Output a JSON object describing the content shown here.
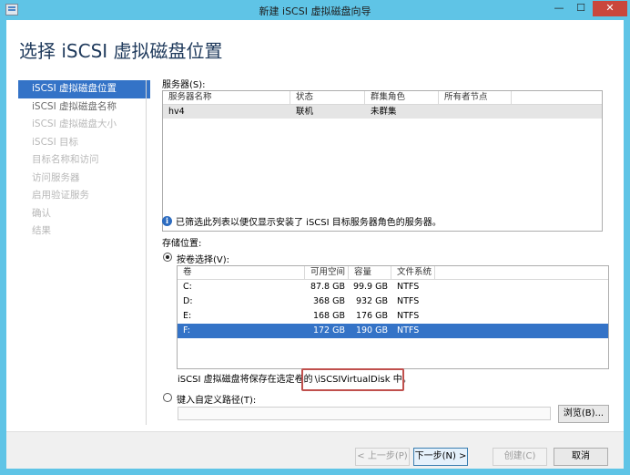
{
  "window": {
    "title": "新建 iSCSI 虚拟磁盘向导",
    "min_glyph": "—",
    "max_glyph": "☐",
    "close_glyph": "✕"
  },
  "page": {
    "title": "选择 iSCSI 虚拟磁盘位置"
  },
  "steps": [
    {
      "label": "iSCSI 虚拟磁盘位置",
      "state": "active"
    },
    {
      "label": "iSCSI 虚拟磁盘名称",
      "state": "done"
    },
    {
      "label": "iSCSI 虚拟磁盘大小",
      "state": "pending"
    },
    {
      "label": "iSCSI 目标",
      "state": "pending"
    },
    {
      "label": "目标名称和访问",
      "state": "pending"
    },
    {
      "label": "访问服务器",
      "state": "pending"
    },
    {
      "label": "启用验证服务",
      "state": "pending"
    },
    {
      "label": "确认",
      "state": "pending"
    },
    {
      "label": "结果",
      "state": "pending"
    }
  ],
  "server": {
    "label": "服务器(S):",
    "columns": [
      "服务器名称",
      "状态",
      "群集角色",
      "所有者节点"
    ],
    "rows": [
      {
        "name": "hv4",
        "status": "联机",
        "cluster_role": "未群集",
        "owner_node": ""
      }
    ],
    "info": "已筛选此列表以便仅显示安装了 iSCSI 目标服务器角色的服务器。"
  },
  "storage": {
    "label": "存储位置:",
    "by_volume_label": "按卷选择(V):",
    "columns": [
      "卷",
      "可用空间",
      "容量",
      "文件系统"
    ],
    "volumes": [
      {
        "volume": "C:",
        "free": "87.8 GB",
        "capacity": "99.9 GB",
        "fs": "NTFS"
      },
      {
        "volume": "D:",
        "free": "368 GB",
        "capacity": "932 GB",
        "fs": "NTFS"
      },
      {
        "volume": "E:",
        "free": "168 GB",
        "capacity": "176 GB",
        "fs": "NTFS"
      },
      {
        "volume": "F:",
        "free": "172 GB",
        "capacity": "190 GB",
        "fs": "NTFS"
      }
    ],
    "selected_volume": "F:",
    "note_prefix": "iSCSI 虚拟磁盘将保存在选定卷的",
    "note_path": "\\iSCSIVirtualDisk 中。",
    "custom_path_label": "键入自定义路径(T):",
    "custom_path_value": "",
    "browse_label": "浏览(B)..."
  },
  "buttons": {
    "previous": "< 上一步(P)",
    "next": "下一步(N) >",
    "create": "创建(C)",
    "cancel": "取消"
  },
  "colors": {
    "title_bar": "#5fc4e6",
    "selection": "#3473c7",
    "highlight_box": "#c0504d"
  }
}
